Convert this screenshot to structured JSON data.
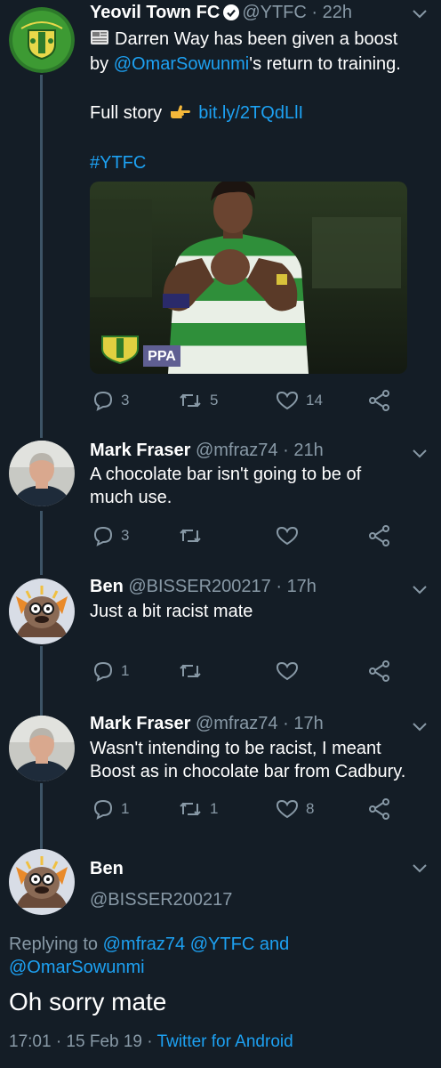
{
  "tweets": [
    {
      "name": "Yeovil Town FC",
      "handle": "@YTFC",
      "time": "22h",
      "text_line1_prefix": "Darren Way has been given a boost",
      "text_line2_prefix": "by ",
      "text_line2_mention": "@OmarSowunmi",
      "text_line2_suffix": "'s return to training.",
      "full_story_label": "Full story",
      "full_story_link": "bit.ly/2TQdLlI",
      "hashtag": "#YTFC",
      "media_badge": "PPA",
      "replies": "3",
      "retweets": "5",
      "likes": "14"
    },
    {
      "name": "Mark Fraser",
      "handle": "@mfraz74",
      "time": "21h",
      "text_line1": "A chocolate bar isn't going to be of",
      "text_line2": "much use.",
      "replies": "3",
      "retweets": "",
      "likes": ""
    },
    {
      "name": "Ben",
      "handle": "@BISSER200217",
      "time": "17h",
      "text_line1": "Just a bit racist mate",
      "replies": "1",
      "retweets": "",
      "likes": ""
    },
    {
      "name": "Mark Fraser",
      "handle": "@mfraz74",
      "time": "17h",
      "text_line1": "Wasn't intending to be racist, I meant",
      "text_line2": "Boost as in chocolate bar from Cadbury.",
      "replies": "1",
      "retweets": "1",
      "likes": "8"
    }
  ],
  "focused": {
    "name": "Ben",
    "handle": "@BISSER200217",
    "replying_prefix": "Replying to",
    "replying_mention1": "@mfraz74",
    "replying_mention2": "@YTFC",
    "replying_and": "and",
    "replying_mention3": "@OmarSowunmi",
    "text": "Oh sorry mate",
    "timestamp": "17:01 · 15 Feb 19 ·",
    "source": "Twitter for Android"
  },
  "separator": "·",
  "colors": {
    "background": "#141d26",
    "link": "#1da1f2",
    "muted": "#8899a6",
    "thread_line": "#3d5466"
  }
}
